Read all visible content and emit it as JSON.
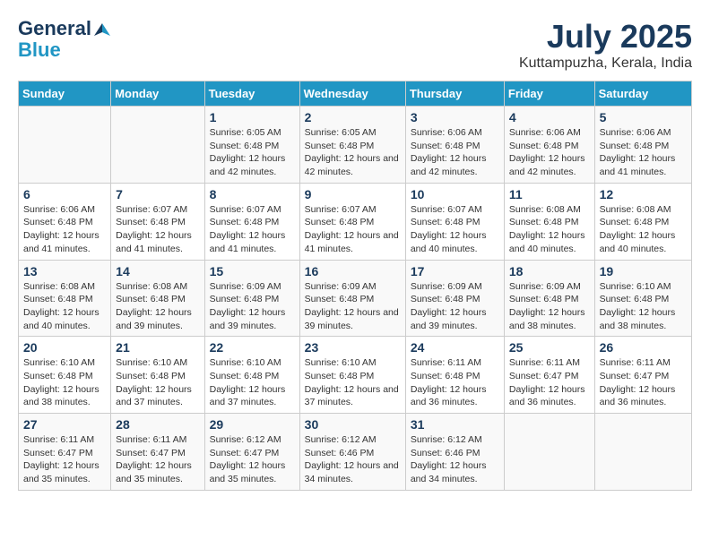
{
  "header": {
    "logo_line1": "General",
    "logo_line2": "Blue",
    "month_year": "July 2025",
    "location": "Kuttampuzha, Kerala, India"
  },
  "days_of_week": [
    "Sunday",
    "Monday",
    "Tuesday",
    "Wednesday",
    "Thursday",
    "Friday",
    "Saturday"
  ],
  "weeks": [
    [
      {
        "day": "",
        "info": ""
      },
      {
        "day": "",
        "info": ""
      },
      {
        "day": "1",
        "info": "Sunrise: 6:05 AM\nSunset: 6:48 PM\nDaylight: 12 hours and 42 minutes."
      },
      {
        "day": "2",
        "info": "Sunrise: 6:05 AM\nSunset: 6:48 PM\nDaylight: 12 hours and 42 minutes."
      },
      {
        "day": "3",
        "info": "Sunrise: 6:06 AM\nSunset: 6:48 PM\nDaylight: 12 hours and 42 minutes."
      },
      {
        "day": "4",
        "info": "Sunrise: 6:06 AM\nSunset: 6:48 PM\nDaylight: 12 hours and 42 minutes."
      },
      {
        "day": "5",
        "info": "Sunrise: 6:06 AM\nSunset: 6:48 PM\nDaylight: 12 hours and 41 minutes."
      }
    ],
    [
      {
        "day": "6",
        "info": "Sunrise: 6:06 AM\nSunset: 6:48 PM\nDaylight: 12 hours and 41 minutes."
      },
      {
        "day": "7",
        "info": "Sunrise: 6:07 AM\nSunset: 6:48 PM\nDaylight: 12 hours and 41 minutes."
      },
      {
        "day": "8",
        "info": "Sunrise: 6:07 AM\nSunset: 6:48 PM\nDaylight: 12 hours and 41 minutes."
      },
      {
        "day": "9",
        "info": "Sunrise: 6:07 AM\nSunset: 6:48 PM\nDaylight: 12 hours and 41 minutes."
      },
      {
        "day": "10",
        "info": "Sunrise: 6:07 AM\nSunset: 6:48 PM\nDaylight: 12 hours and 40 minutes."
      },
      {
        "day": "11",
        "info": "Sunrise: 6:08 AM\nSunset: 6:48 PM\nDaylight: 12 hours and 40 minutes."
      },
      {
        "day": "12",
        "info": "Sunrise: 6:08 AM\nSunset: 6:48 PM\nDaylight: 12 hours and 40 minutes."
      }
    ],
    [
      {
        "day": "13",
        "info": "Sunrise: 6:08 AM\nSunset: 6:48 PM\nDaylight: 12 hours and 40 minutes."
      },
      {
        "day": "14",
        "info": "Sunrise: 6:08 AM\nSunset: 6:48 PM\nDaylight: 12 hours and 39 minutes."
      },
      {
        "day": "15",
        "info": "Sunrise: 6:09 AM\nSunset: 6:48 PM\nDaylight: 12 hours and 39 minutes."
      },
      {
        "day": "16",
        "info": "Sunrise: 6:09 AM\nSunset: 6:48 PM\nDaylight: 12 hours and 39 minutes."
      },
      {
        "day": "17",
        "info": "Sunrise: 6:09 AM\nSunset: 6:48 PM\nDaylight: 12 hours and 39 minutes."
      },
      {
        "day": "18",
        "info": "Sunrise: 6:09 AM\nSunset: 6:48 PM\nDaylight: 12 hours and 38 minutes."
      },
      {
        "day": "19",
        "info": "Sunrise: 6:10 AM\nSunset: 6:48 PM\nDaylight: 12 hours and 38 minutes."
      }
    ],
    [
      {
        "day": "20",
        "info": "Sunrise: 6:10 AM\nSunset: 6:48 PM\nDaylight: 12 hours and 38 minutes."
      },
      {
        "day": "21",
        "info": "Sunrise: 6:10 AM\nSunset: 6:48 PM\nDaylight: 12 hours and 37 minutes."
      },
      {
        "day": "22",
        "info": "Sunrise: 6:10 AM\nSunset: 6:48 PM\nDaylight: 12 hours and 37 minutes."
      },
      {
        "day": "23",
        "info": "Sunrise: 6:10 AM\nSunset: 6:48 PM\nDaylight: 12 hours and 37 minutes."
      },
      {
        "day": "24",
        "info": "Sunrise: 6:11 AM\nSunset: 6:48 PM\nDaylight: 12 hours and 36 minutes."
      },
      {
        "day": "25",
        "info": "Sunrise: 6:11 AM\nSunset: 6:47 PM\nDaylight: 12 hours and 36 minutes."
      },
      {
        "day": "26",
        "info": "Sunrise: 6:11 AM\nSunset: 6:47 PM\nDaylight: 12 hours and 36 minutes."
      }
    ],
    [
      {
        "day": "27",
        "info": "Sunrise: 6:11 AM\nSunset: 6:47 PM\nDaylight: 12 hours and 35 minutes."
      },
      {
        "day": "28",
        "info": "Sunrise: 6:11 AM\nSunset: 6:47 PM\nDaylight: 12 hours and 35 minutes."
      },
      {
        "day": "29",
        "info": "Sunrise: 6:12 AM\nSunset: 6:47 PM\nDaylight: 12 hours and 35 minutes."
      },
      {
        "day": "30",
        "info": "Sunrise: 6:12 AM\nSunset: 6:46 PM\nDaylight: 12 hours and 34 minutes."
      },
      {
        "day": "31",
        "info": "Sunrise: 6:12 AM\nSunset: 6:46 PM\nDaylight: 12 hours and 34 minutes."
      },
      {
        "day": "",
        "info": ""
      },
      {
        "day": "",
        "info": ""
      }
    ]
  ]
}
